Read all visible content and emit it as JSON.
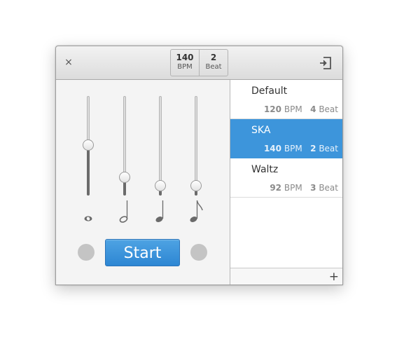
{
  "header": {
    "close_glyph": "×",
    "tempo": {
      "bpm_value": "140",
      "bpm_label": "BPM",
      "beat_value": "2",
      "beat_label": "Beat"
    },
    "exit_icon": "exit-icon"
  },
  "sliders": [
    {
      "note": "whole-note-icon",
      "level": 0.51
    },
    {
      "note": "half-note-icon",
      "level": 0.14
    },
    {
      "note": "quarter-note-icon",
      "level": 0.05
    },
    {
      "note": "eighth-note-icon",
      "level": 0.05
    }
  ],
  "start_button": {
    "label": "Start"
  },
  "presets": [
    {
      "name": "Default",
      "bpm": "120",
      "bpm_label": "BPM",
      "beat": "4",
      "beat_label": "Beat",
      "selected": false
    },
    {
      "name": "SKA",
      "bpm": "140",
      "bpm_label": "BPM",
      "beat": "2",
      "beat_label": "Beat",
      "selected": true
    },
    {
      "name": "Waltz",
      "bpm": "92",
      "bpm_label": "BPM",
      "beat": "3",
      "beat_label": "Beat",
      "selected": false
    }
  ],
  "footer": {
    "add_glyph": "+"
  },
  "colors": {
    "accent": "#3d95db",
    "start": "#3a93dc",
    "indicator": "#c4c4c4"
  }
}
